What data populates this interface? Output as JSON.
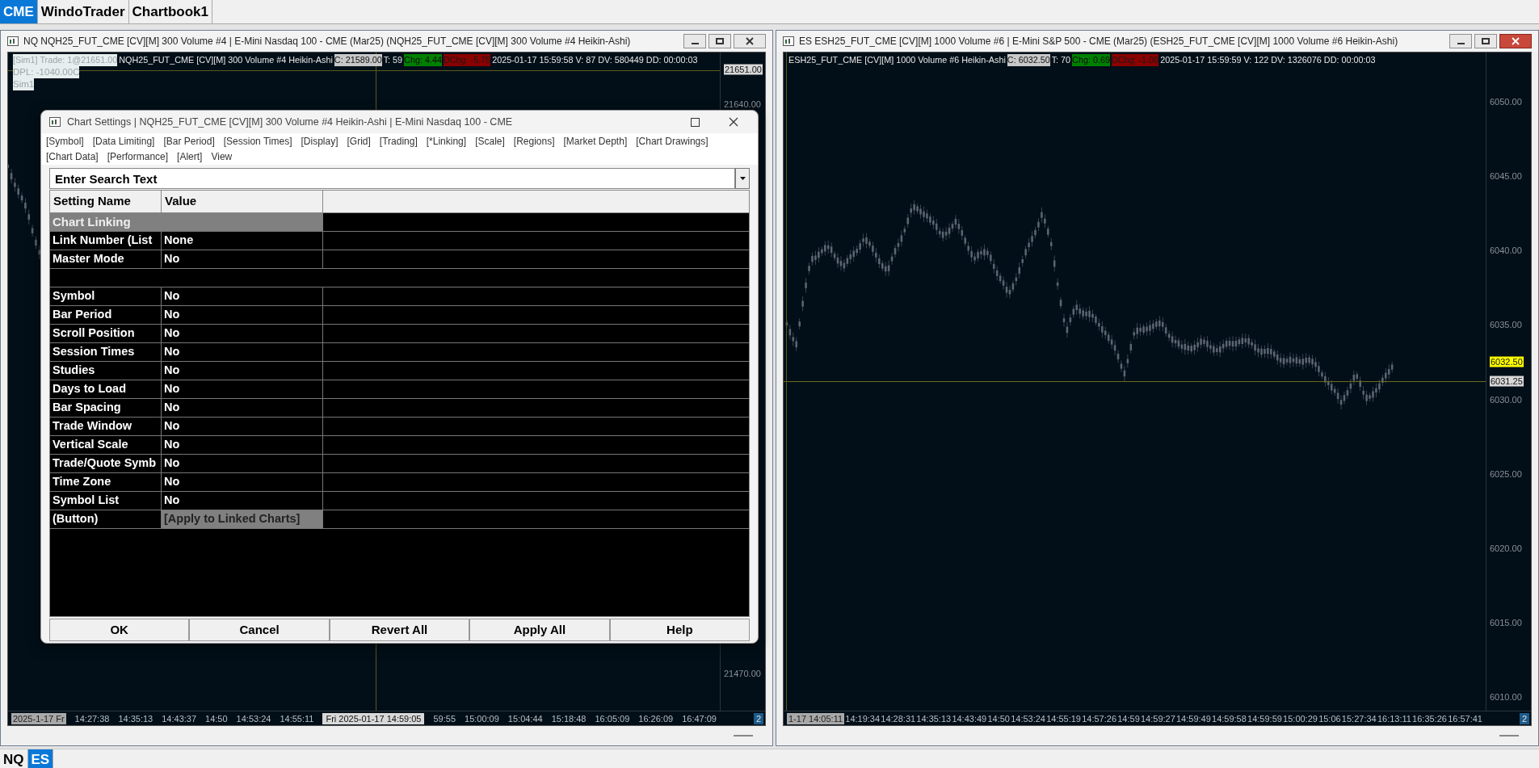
{
  "top_tabs": [
    {
      "label": "CME",
      "selected": true
    },
    {
      "label": "WindoTrader",
      "selected": false
    },
    {
      "label": "Chartbook1",
      "selected": false
    }
  ],
  "charts": [
    {
      "title": "NQ NQH25_FUT_CME [CV][M]  300 Volume #4 | E-Mini Nasdaq 100 - CME (Mar25) (NQH25_FUT_CME [CV][M]  300 Volume #4 Heikin-Ashi)",
      "active": false,
      "info": [
        {
          "text": "[Sim1]  Trade: 1@21651.00",
          "kind": "light"
        },
        {
          "text": "NQH25_FUT_CME [CV][M]  300 Volume #4 Heikin-Ashi",
          "kind": "plain"
        },
        {
          "text": "C: 21589.00",
          "kind": "grey"
        },
        {
          "text": "T: 59",
          "kind": "plain"
        },
        {
          "text": "Chg: 4.44",
          "kind": "up"
        },
        {
          "text": "DChg: -5.75",
          "kind": "down"
        },
        {
          "text": "2025-01-17 15:59:58 V: 87 DV: 580449 DD: 00:00:03",
          "kind": "plain"
        }
      ],
      "info_extra": [
        "DPL: -1040.00C",
        "Sim1"
      ],
      "price_labels": [
        {
          "text": "21651.00",
          "kind": "cursor"
        },
        {
          "text": "21640.00",
          "kind": "tick"
        },
        {
          "text": "21470.00",
          "kind": "tick"
        }
      ],
      "time_labels": [
        {
          "text": "2025-1-17 Fr",
          "kind": "start"
        },
        {
          "text": "14:27:38",
          "kind": "tick"
        },
        {
          "text": "14:35:13",
          "kind": "tick"
        },
        {
          "text": "14:43:37",
          "kind": "tick"
        },
        {
          "text": "14:50",
          "kind": "tick"
        },
        {
          "text": "14:53:24",
          "kind": "tick"
        },
        {
          "text": "14:55:11",
          "kind": "tick"
        },
        {
          "text": "Fri 2025-01-17  14:59:05",
          "kind": "cursor"
        },
        {
          "text": "59:55",
          "kind": "tick"
        },
        {
          "text": "15:00:09",
          "kind": "tick"
        },
        {
          "text": "15:04:44",
          "kind": "tick"
        },
        {
          "text": "15:18:48",
          "kind": "tick"
        },
        {
          "text": "16:05:09",
          "kind": "tick"
        },
        {
          "text": "16:26:09",
          "kind": "tick"
        },
        {
          "text": "16:47:09",
          "kind": "tick"
        }
      ],
      "badge": "2"
    },
    {
      "title": "ES ESH25_FUT_CME [CV][M]  1000 Volume #6 | E-Mini S&P 500 - CME (Mar25) (ESH25_FUT_CME [CV][M]  1000 Volume #6 Heikin-Ashi)",
      "active": true,
      "info": [
        {
          "text": "ESH25_FUT_CME [CV][M]  1000 Volume #6 Heikin-Ashi",
          "kind": "plain"
        },
        {
          "text": "C: 6032.50",
          "kind": "grey"
        },
        {
          "text": "T: 70",
          "kind": "plain"
        },
        {
          "text": "Chg: 0.69",
          "kind": "up"
        },
        {
          "text": "DChg: -1.00",
          "kind": "down"
        },
        {
          "text": "2025-01-17 15:59:59 V: 122 DV: 1326076 DD: 00:00:03",
          "kind": "plain"
        }
      ],
      "price_labels": [
        {
          "text": "6050.00",
          "kind": "tick"
        },
        {
          "text": "6045.00",
          "kind": "tick"
        },
        {
          "text": "6040.00",
          "kind": "tick"
        },
        {
          "text": "6035.00",
          "kind": "tick"
        },
        {
          "text": "6032.50",
          "kind": "last"
        },
        {
          "text": "6031.25",
          "kind": "cursor"
        },
        {
          "text": "6030.00",
          "kind": "tick"
        },
        {
          "text": "6025.00",
          "kind": "tick"
        },
        {
          "text": "6020.00",
          "kind": "tick"
        },
        {
          "text": "6015.00",
          "kind": "tick"
        },
        {
          "text": "6010.00",
          "kind": "tick"
        }
      ],
      "time_labels": [
        {
          "text": "1-17  14:05:11",
          "kind": "start"
        },
        {
          "text": "14:19:34",
          "kind": "tick"
        },
        {
          "text": "14:28:31",
          "kind": "tick"
        },
        {
          "text": "14:35:13",
          "kind": "tick"
        },
        {
          "text": "14:43:49",
          "kind": "tick"
        },
        {
          "text": "14:50",
          "kind": "tick"
        },
        {
          "text": "14:53:24",
          "kind": "tick"
        },
        {
          "text": "14:55:19",
          "kind": "tick"
        },
        {
          "text": "14:57:26",
          "kind": "tick"
        },
        {
          "text": "14:59",
          "kind": "tick"
        },
        {
          "text": "14:59:27",
          "kind": "tick"
        },
        {
          "text": "14:59:49",
          "kind": "tick"
        },
        {
          "text": "14:59:58",
          "kind": "tick"
        },
        {
          "text": "14:59:59",
          "kind": "tick"
        },
        {
          "text": "15:00:29",
          "kind": "tick"
        },
        {
          "text": "15:06",
          "kind": "tick"
        },
        {
          "text": "15:27:34",
          "kind": "tick"
        },
        {
          "text": "16:13:11",
          "kind": "tick"
        },
        {
          "text": "16:35:26",
          "kind": "tick"
        },
        {
          "text": "16:57:41",
          "kind": "tick"
        }
      ],
      "badge": "2"
    }
  ],
  "dialog": {
    "title": "Chart Settings | NQH25_FUT_CME [CV][M]  300 Volume #4 Heikin-Ashi | E-Mini Nasdaq 100 - CME",
    "menu": [
      "[Symbol]",
      "[Data Limiting]",
      "[Bar Period]",
      "[Session Times]",
      "[Display]",
      "[Grid]",
      "[Trading]",
      "[*Linking]",
      "[Scale]",
      "[Regions]",
      "[Market Depth]",
      "[Chart Drawings]",
      "[Chart Data]",
      "[Performance]",
      "[Alert]",
      "View"
    ],
    "search": {
      "placeholder": "Enter Search Text"
    },
    "columns": [
      "Setting Name",
      "Value"
    ],
    "rows": [
      {
        "kind": "section",
        "name": "Chart Linking"
      },
      {
        "kind": "setting",
        "name": "Link Number (List",
        "value": "None"
      },
      {
        "kind": "setting",
        "name": "Master Mode",
        "value": "No"
      },
      {
        "kind": "blank"
      },
      {
        "kind": "setting",
        "name": "Symbol",
        "value": "No"
      },
      {
        "kind": "setting",
        "name": "Bar Period",
        "value": "No"
      },
      {
        "kind": "setting",
        "name": "Scroll Position",
        "value": "No"
      },
      {
        "kind": "setting",
        "name": "Session Times",
        "value": "No"
      },
      {
        "kind": "setting",
        "name": "Studies",
        "value": "No"
      },
      {
        "kind": "setting",
        "name": "Days to Load",
        "value": "No"
      },
      {
        "kind": "setting",
        "name": "Bar Spacing",
        "value": "No"
      },
      {
        "kind": "setting",
        "name": "Trade Window",
        "value": "No"
      },
      {
        "kind": "setting",
        "name": "Vertical Scale",
        "value": "No"
      },
      {
        "kind": "setting",
        "name": "Trade/Quote Symb",
        "value": "No"
      },
      {
        "kind": "setting",
        "name": "Time Zone",
        "value": "No"
      },
      {
        "kind": "setting",
        "name": "Symbol List",
        "value": "No"
      },
      {
        "kind": "button",
        "name": "(Button)",
        "value": "[Apply to Linked Charts]"
      }
    ],
    "buttons": [
      "OK",
      "Cancel",
      "Revert All",
      "Apply All",
      "Help"
    ]
  },
  "bottom_tabs": [
    {
      "label": "NQ",
      "selected": false
    },
    {
      "label": "ES",
      "selected": true
    }
  ]
}
